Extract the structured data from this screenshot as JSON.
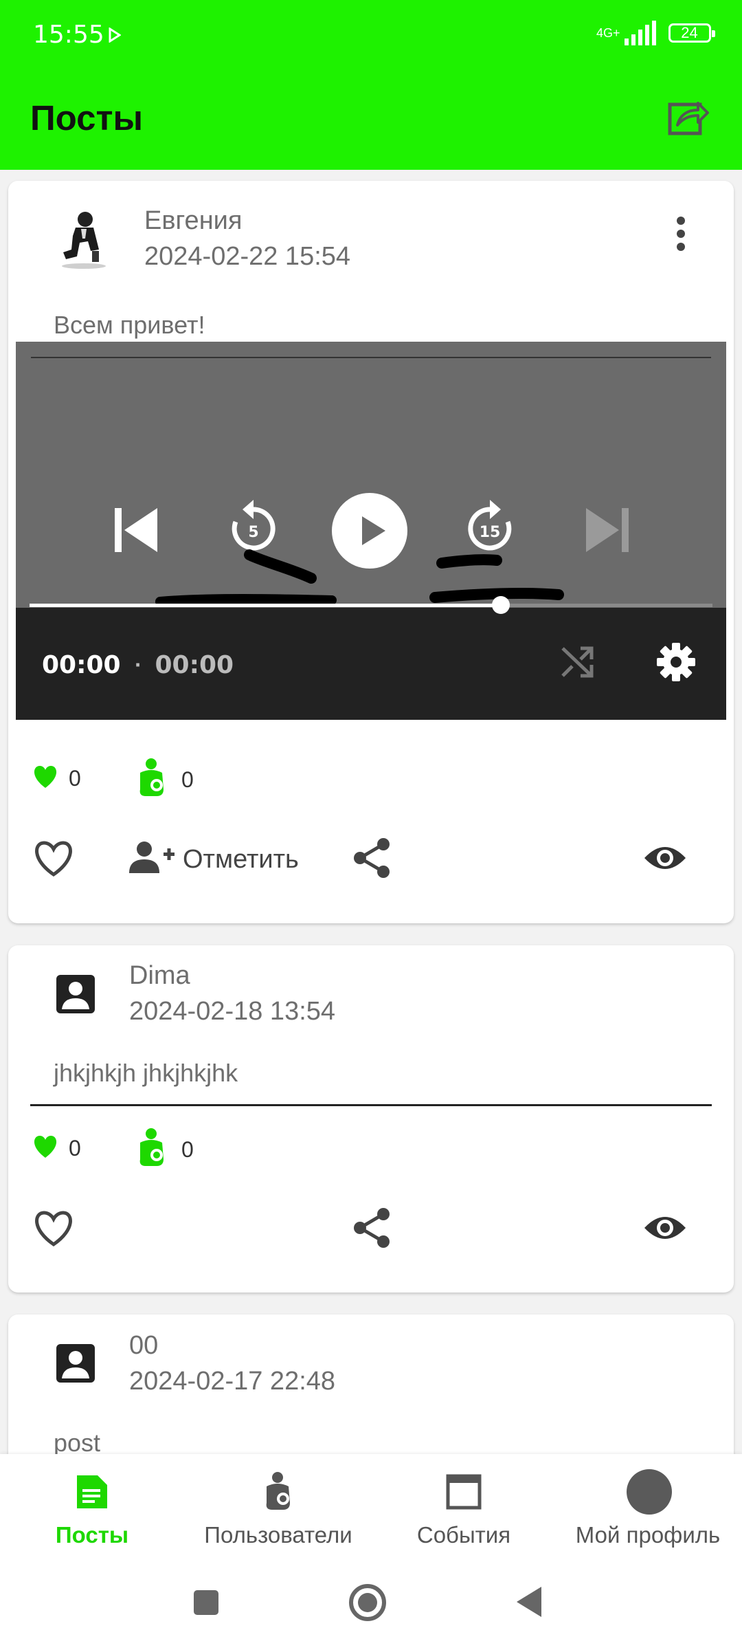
{
  "status_bar": {
    "time": "15:55",
    "network": "4G+",
    "battery": "24"
  },
  "app_bar": {
    "title": "Посты"
  },
  "posts": [
    {
      "author": "Евгения",
      "date": "2024-02-22 15:54",
      "text": "Всем привет!",
      "video": {
        "current_time": "00:00",
        "separator": "·",
        "duration": "00:00",
        "rewind_seconds": "5",
        "forward_seconds": "15",
        "progress": 0.69
      },
      "likes": "0",
      "marks": "0",
      "mark_label": "Отметить"
    },
    {
      "author": "Dima",
      "date": "2024-02-18 13:54",
      "text": "jhkjhkjh jhkjhkjhk",
      "likes": "0",
      "marks": "0"
    },
    {
      "author": "00",
      "date": "2024-02-17 22:48",
      "text": "post"
    }
  ],
  "bottom_nav": {
    "items": [
      {
        "label": "Посты",
        "icon": "document-icon",
        "active": true
      },
      {
        "label": "Пользователи",
        "icon": "user-baby-icon",
        "active": false
      },
      {
        "label": "События",
        "icon": "window-icon",
        "active": false
      },
      {
        "label": "Мой профиль",
        "icon": "avatar-circle-icon",
        "active": false
      }
    ]
  },
  "colors": {
    "accent": "#1ef200",
    "text_muted": "#6e6e6e",
    "nav_inactive": "#555555"
  }
}
